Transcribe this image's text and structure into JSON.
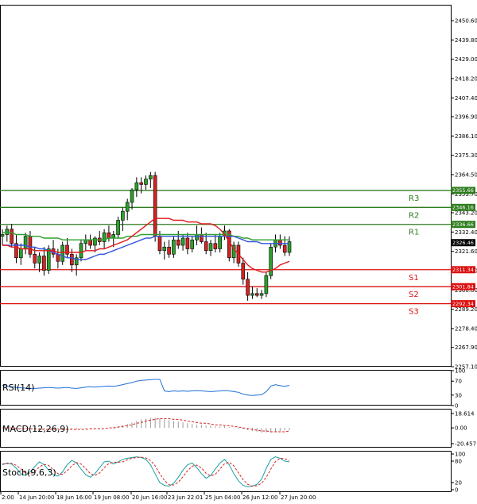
{
  "chart_data": {
    "type": "candlestick",
    "price_axis": {
      "ticks": [
        "2450.60",
        "2439.80",
        "2429.00",
        "2418.20",
        "2407.40",
        "2396.90",
        "2386.10",
        "2375.30",
        "2364.50",
        "2353.70",
        "2343.20",
        "2332.40",
        "2321.60",
        "2310.80",
        "2300.00",
        "2289.20",
        "2278.40",
        "2267.90",
        "2257.10"
      ],
      "range": [
        2257.1,
        2450.6
      ]
    },
    "time_axis": {
      "labels": [
        "2:00",
        "14 Jun 20:00",
        "18 Jun 16:00",
        "19 Jun 08:00",
        "20 Jun 16:00",
        "23 Jun 22:01",
        "25 Jun 04:00",
        "26 Jun 12:00",
        "27 Jun 20:00"
      ]
    },
    "current_price": "2326.46",
    "levels": [
      {
        "name": "R3",
        "value": 2355.66,
        "label": "2355.66",
        "color": "#2e7d1f"
      },
      {
        "name": "R2",
        "value": 2346.16,
        "label": "2346.16",
        "color": "#2e7d1f"
      },
      {
        "name": "R1",
        "value": 2336.66,
        "label": "2336.66",
        "color": "#2e7d1f"
      },
      {
        "name": "S1",
        "value": 2311.34,
        "label": "2311.34",
        "color": "#dd1111"
      },
      {
        "name": "S2",
        "value": 2301.84,
        "label": "2301.84",
        "color": "#dd1111"
      },
      {
        "name": "S3",
        "value": 2292.34,
        "label": "2292.34",
        "color": "#dd1111"
      }
    ],
    "candles": [
      [
        2330,
        2334,
        2325,
        2331
      ],
      [
        2331,
        2336,
        2327,
        2334
      ],
      [
        2334,
        2337,
        2324,
        2326
      ],
      [
        2326,
        2331,
        2315,
        2318
      ],
      [
        2318,
        2326,
        2314,
        2323
      ],
      [
        2323,
        2332,
        2320,
        2330
      ],
      [
        2330,
        2333,
        2318,
        2320
      ],
      [
        2320,
        2324,
        2312,
        2315
      ],
      [
        2315,
        2321,
        2310,
        2319
      ],
      [
        2319,
        2324,
        2308,
        2311
      ],
      [
        2311,
        2325,
        2309,
        2323
      ],
      [
        2323,
        2328,
        2318,
        2320
      ],
      [
        2320,
        2323,
        2312,
        2316
      ],
      [
        2316,
        2327,
        2314,
        2325
      ],
      [
        2325,
        2329,
        2318,
        2320
      ],
      [
        2320,
        2323,
        2310,
        2314
      ],
      [
        2314,
        2320,
        2308,
        2318
      ],
      [
        2318,
        2328,
        2316,
        2326
      ],
      [
        2326,
        2331,
        2322,
        2328
      ],
      [
        2328,
        2331,
        2323,
        2325
      ],
      [
        2325,
        2330,
        2321,
        2329
      ],
      [
        2329,
        2333,
        2325,
        2327
      ],
      [
        2327,
        2334,
        2323,
        2332
      ],
      [
        2332,
        2336,
        2327,
        2329
      ],
      [
        2329,
        2333,
        2324,
        2331
      ],
      [
        2331,
        2341,
        2329,
        2339
      ],
      [
        2339,
        2346,
        2333,
        2344
      ],
      [
        2344,
        2351,
        2339,
        2349
      ],
      [
        2349,
        2357,
        2345,
        2356
      ],
      [
        2356,
        2363,
        2352,
        2360
      ],
      [
        2360,
        2363,
        2354,
        2359
      ],
      [
        2359,
        2364,
        2356,
        2362
      ],
      [
        2362,
        2366,
        2357,
        2364
      ],
      [
        2364,
        2366,
        2327,
        2330
      ],
      [
        2330,
        2333,
        2320,
        2322
      ],
      [
        2322,
        2327,
        2317,
        2324
      ],
      [
        2324,
        2328,
        2318,
        2320
      ],
      [
        2320,
        2330,
        2318,
        2328
      ],
      [
        2328,
        2333,
        2323,
        2325
      ],
      [
        2325,
        2331,
        2322,
        2329
      ],
      [
        2329,
        2332,
        2320,
        2323
      ],
      [
        2323,
        2330,
        2321,
        2328
      ],
      [
        2328,
        2336,
        2325,
        2331
      ],
      [
        2331,
        2335,
        2326,
        2327
      ],
      [
        2327,
        2332,
        2320,
        2322
      ],
      [
        2322,
        2328,
        2319,
        2326
      ],
      [
        2326,
        2331,
        2321,
        2323
      ],
      [
        2323,
        2332,
        2321,
        2330
      ],
      [
        2330,
        2336,
        2328,
        2333
      ],
      [
        2333,
        2334,
        2316,
        2318
      ],
      [
        2318,
        2327,
        2315,
        2325
      ],
      [
        2325,
        2327,
        2313,
        2315
      ],
      [
        2315,
        2318,
        2303,
        2306
      ],
      [
        2306,
        2310,
        2294,
        2297
      ],
      [
        2297,
        2302,
        2295,
        2298
      ],
      [
        2298,
        2301,
        2296,
        2297
      ],
      [
        2297,
        2300,
        2295,
        2298
      ],
      [
        2298,
        2310,
        2296,
        2308
      ],
      [
        2308,
        2326,
        2306,
        2324
      ],
      [
        2324,
        2331,
        2321,
        2328
      ],
      [
        2328,
        2331,
        2323,
        2325
      ],
      [
        2325,
        2330,
        2319,
        2321
      ],
      [
        2321,
        2330,
        2319,
        2327
      ]
    ],
    "ma_red": [
      2325,
      2325,
      2324,
      2324,
      2323,
      2323,
      2323,
      2322,
      2322,
      2322,
      2322,
      2322,
      2321,
      2321,
      2321,
      2321,
      2321,
      2321,
      2322,
      2322,
      2322,
      2323,
      2323,
      2324,
      2325,
      2326,
      2327,
      2328,
      2330,
      2332,
      2334,
      2336,
      2338,
      2340,
      2340,
      2340,
      2340,
      2339,
      2339,
      2339,
      2338,
      2338,
      2338,
      2337,
      2337,
      2337,
      2336,
      2334,
      2331,
      2327,
      2323,
      2320,
      2317,
      2314,
      2312,
      2311,
      2310,
      2310,
      2311,
      2312,
      2314,
      2315,
      2316
    ],
    "ma_blue": [
      2325,
      2325,
      2325,
      2325,
      2325,
      2325,
      2324,
      2324,
      2323,
      2323,
      2322,
      2321,
      2320,
      2319,
      2318,
      2318,
      2317,
      2317,
      2317,
      2318,
      2319,
      2320,
      2320,
      2321,
      2322,
      2323,
      2324,
      2325,
      2326,
      2327,
      2328,
      2329,
      2329,
      2330,
      2330,
      2330,
      2330,
      2330,
      2330,
      2330,
      2330,
      2330,
      2330,
      2330,
      2330,
      2330,
      2330,
      2330,
      2330,
      2330,
      2330,
      2329,
      2328,
      2327,
      2327,
      2327,
      2326,
      2326,
      2326,
      2326,
      2326,
      2326,
      2326
    ],
    "ma_green": [
      2332,
      2332,
      2332,
      2331,
      2331,
      2331,
      2330,
      2330,
      2330,
      2329,
      2329,
      2329,
      2329,
      2328,
      2328,
      2328,
      2328,
      2328,
      2328,
      2328,
      2328,
      2328,
      2328,
      2329,
      2329,
      2329,
      2329,
      2330,
      2330,
      2330,
      2331,
      2331,
      2331,
      2331,
      2331,
      2331,
      2331,
      2331,
      2331,
      2331,
      2331,
      2331,
      2331,
      2331,
      2331,
      2331,
      2331,
      2331,
      2331,
      2331,
      2330,
      2330,
      2329,
      2329,
      2328,
      2328,
      2328,
      2328,
      2328,
      2328,
      2328,
      2328,
      2328
    ],
    "rsi": {
      "label": "RSI(14)",
      "ticks": [
        "100",
        "70",
        "30",
        "0"
      ],
      "values": [
        58,
        56,
        54,
        52,
        51,
        50,
        49,
        49,
        50,
        51,
        52,
        51,
        50,
        51,
        52,
        50,
        49,
        51,
        53,
        54,
        53,
        54,
        55,
        56,
        55,
        57,
        60,
        63,
        66,
        70,
        72,
        73,
        74,
        75,
        75,
        42,
        40,
        42,
        41,
        42,
        41,
        42,
        43,
        42,
        41,
        40,
        41,
        42,
        43,
        42,
        40,
        38,
        33,
        30,
        29,
        30,
        31,
        40,
        56,
        60,
        57,
        55,
        58
      ]
    },
    "macd": {
      "label": "MACD(12,26,9)",
      "ticks": [
        "18.614",
        "0.00",
        "-20.457"
      ],
      "hist": [
        0,
        0,
        0,
        -1,
        -1,
        -1,
        -1,
        -2,
        -2,
        -2,
        -2,
        -2,
        -2,
        -2,
        -2,
        -2,
        -2,
        -1,
        -1,
        -1,
        -1,
        -1,
        0,
        0,
        1,
        2,
        3,
        5,
        7,
        9,
        11,
        12,
        13,
        13,
        12,
        11,
        10,
        9,
        8,
        7,
        6,
        5,
        4,
        4,
        3,
        3,
        2,
        2,
        2,
        1,
        0,
        -1,
        -2,
        -3,
        -4,
        -5,
        -6,
        -6,
        -6,
        -5,
        -4,
        -3,
        -3
      ],
      "signal": [
        0,
        0,
        0,
        -1,
        -1,
        -1,
        -1,
        -1,
        -2,
        -2,
        -2,
        -2,
        -2,
        -2,
        -2,
        -2,
        -2,
        -2,
        -2,
        -1,
        -1,
        -1,
        -1,
        0,
        0,
        1,
        2,
        3,
        4,
        6,
        7,
        9,
        10,
        11,
        12,
        12,
        12,
        11,
        11,
        10,
        9,
        8,
        7,
        6,
        6,
        5,
        4,
        4,
        3,
        3,
        2,
        1,
        0,
        -1,
        -2,
        -3,
        -4,
        -4,
        -5,
        -5,
        -5,
        -5,
        -4
      ]
    },
    "stoch": {
      "label": "Stoch(9,6,3)",
      "ticks": [
        "100",
        "80",
        "20",
        "0"
      ],
      "k": [
        70,
        75,
        72,
        60,
        45,
        40,
        50,
        65,
        78,
        70,
        55,
        42,
        38,
        50,
        70,
        82,
        75,
        58,
        42,
        35,
        45,
        62,
        78,
        80,
        72,
        78,
        85,
        88,
        90,
        92,
        90,
        85,
        70,
        45,
        20,
        12,
        10,
        18,
        35,
        55,
        70,
        75,
        62,
        45,
        32,
        40,
        58,
        75,
        85,
        70,
        45,
        25,
        12,
        8,
        10,
        15,
        30,
        60,
        85,
        92,
        88,
        80,
        78
      ],
      "d": [
        72,
        73,
        74,
        68,
        58,
        47,
        45,
        52,
        64,
        71,
        68,
        56,
        45,
        43,
        53,
        67,
        76,
        72,
        59,
        45,
        40,
        47,
        62,
        73,
        77,
        77,
        78,
        84,
        88,
        90,
        91,
        89,
        82,
        67,
        45,
        26,
        14,
        13,
        21,
        36,
        53,
        66,
        69,
        61,
        46,
        39,
        43,
        58,
        73,
        77,
        67,
        47,
        28,
        15,
        10,
        11,
        18,
        35,
        58,
        79,
        88,
        87,
        82
      ]
    }
  }
}
